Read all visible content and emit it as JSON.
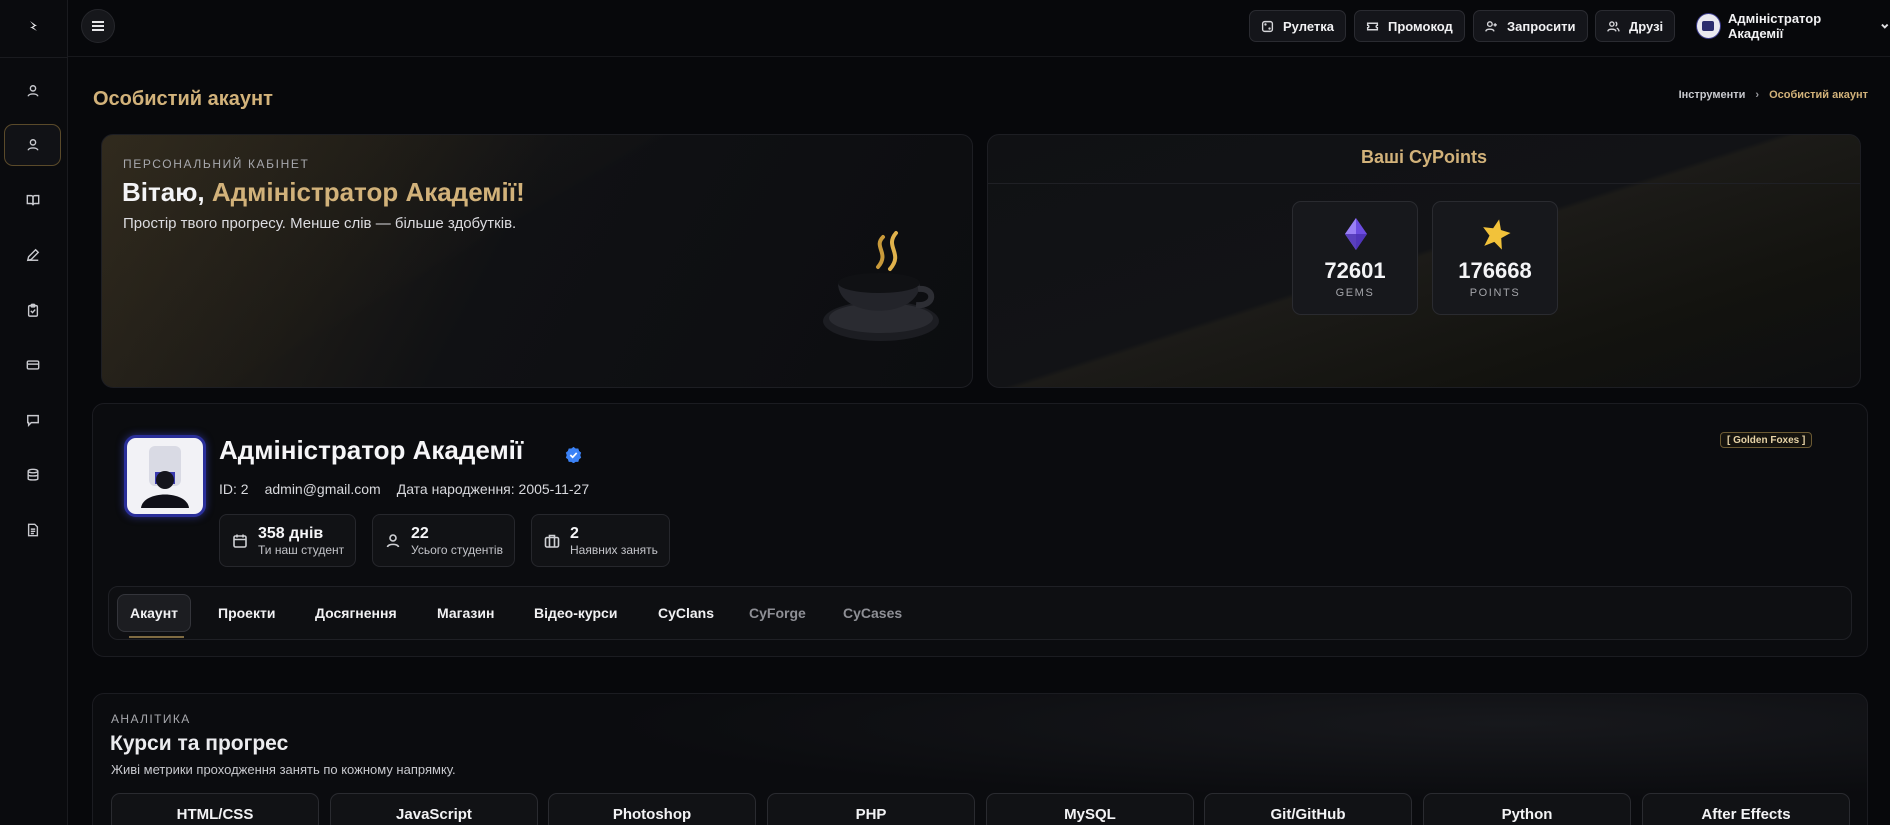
{
  "sidebar": {
    "items": [
      {
        "icon": "user-icon"
      },
      {
        "icon": "profile-icon",
        "active": true
      },
      {
        "icon": "book-icon"
      },
      {
        "icon": "pencil-icon"
      },
      {
        "icon": "clipboard-icon"
      },
      {
        "icon": "card-icon"
      },
      {
        "icon": "chat-icon"
      },
      {
        "icon": "database-icon"
      },
      {
        "icon": "document-icon"
      }
    ]
  },
  "header": {
    "buttons": [
      {
        "label": "Рулетка",
        "icon": "dice-icon"
      },
      {
        "label": "Промокод",
        "icon": "ticket-icon"
      },
      {
        "label": "Запросити",
        "icon": "user-plus-icon"
      },
      {
        "label": "Друзі",
        "icon": "users-icon"
      }
    ],
    "user_name": "Адміністратор Академії"
  },
  "page": {
    "title": "Особистий акаунт",
    "breadcrumb": [
      "Інструменти",
      "Особистий акаунт"
    ]
  },
  "welcome": {
    "kicker": "ПЕРСОНАЛЬНИЙ КАБІНЕТ",
    "greeting": "Вітаю,",
    "name": "Адміністратор Академії!",
    "subtitle": "Простір твого прогресу. Менше слів — більше здобутків."
  },
  "cypoints": {
    "title": "Ваші CyPoints",
    "gems": {
      "value": "72601",
      "label": "GEMS"
    },
    "points": {
      "value": "176668",
      "label": "POINTS"
    }
  },
  "profile": {
    "name": "Адміністратор Академії",
    "clan": "[ Golden Foxes ]",
    "id": "ID: 2",
    "email": "admin@gmail.com",
    "birthday": "Дата народження: 2005-11-27",
    "stats": [
      {
        "value": "358 днів",
        "label": "Ти наш студент",
        "icon": "calendar-icon"
      },
      {
        "value": "22",
        "label": "Усього студентів",
        "icon": "student-icon"
      },
      {
        "value": "2",
        "label": "Наявних занять",
        "icon": "briefcase-icon"
      }
    ],
    "tabs": [
      "Акаунт",
      "Проекти",
      "Досягнення",
      "Магазин",
      "Відео-курси",
      "CyClans",
      "CyForge",
      "CyCases"
    ]
  },
  "analytics": {
    "kicker": "АНАЛІТИКА",
    "title": "Курси та прогрес",
    "subtitle": "Живі метрики проходження занять по кожному напрямку.",
    "courses": [
      "HTML/CSS",
      "JavaScript",
      "Photoshop",
      "PHP",
      "MySQL",
      "Git/GitHub",
      "Python",
      "After Effects"
    ]
  },
  "colors": {
    "accent": "#d2b27a",
    "background": "#07080b"
  }
}
